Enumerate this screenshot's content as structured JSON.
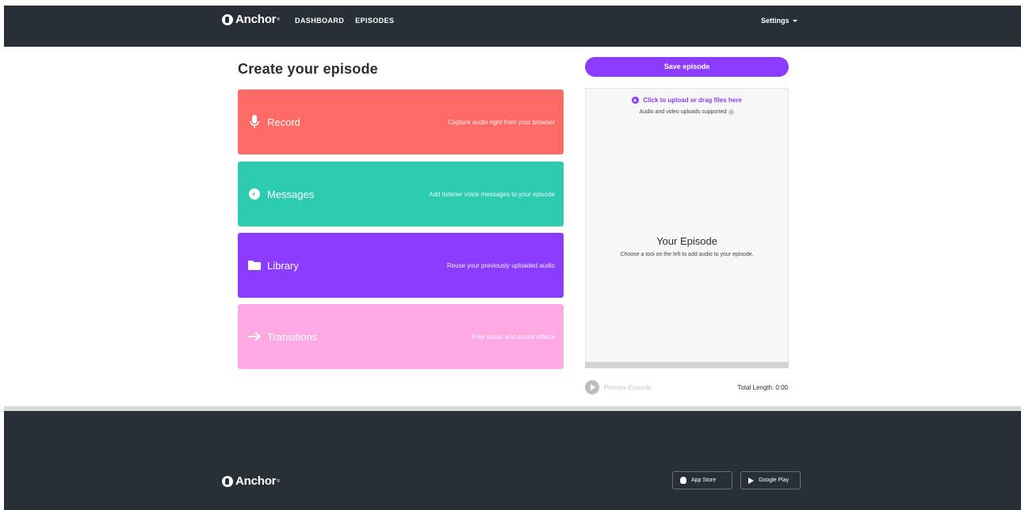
{
  "app": {
    "brand": "Anchor",
    "brand_tm": "®"
  },
  "nav": {
    "links": [
      "DASHBOARD",
      "EPISODES"
    ],
    "settings": "Settings"
  },
  "main": {
    "title": "Create your episode",
    "tools": [
      {
        "label": "Record",
        "description": "Capture audio right from your browser",
        "color": "#fe6b66",
        "icon": "microphone-icon"
      },
      {
        "label": "Messages",
        "description": "Add listener voice messages to your episode",
        "color": "#2dccb0",
        "icon": "message-icon"
      },
      {
        "label": "Library",
        "description": "Reuse your previously uploaded audio",
        "color": "#8b3cff",
        "icon": "folder-icon"
      },
      {
        "label": "Transitions",
        "description": "Free music and sound effects",
        "color": "#fdaae4",
        "icon": "arrow-right-icon"
      }
    ]
  },
  "episode": {
    "save_label": "Save episode",
    "upload_link": "Click to upload or drag files here",
    "upload_note": "Audio and video uploads supported",
    "title": "Your Episode",
    "hint": "Choose a tool on the left to add audio to your episode.",
    "preview_label": "Preview Episode",
    "total_length": "Total Length: 0:00"
  },
  "footer": {
    "brand": "Anchor",
    "app_store": "App Store",
    "google_play": "Google Play"
  },
  "colors": {
    "accent": "#8b3cff",
    "nav_bg": "#292f36"
  }
}
